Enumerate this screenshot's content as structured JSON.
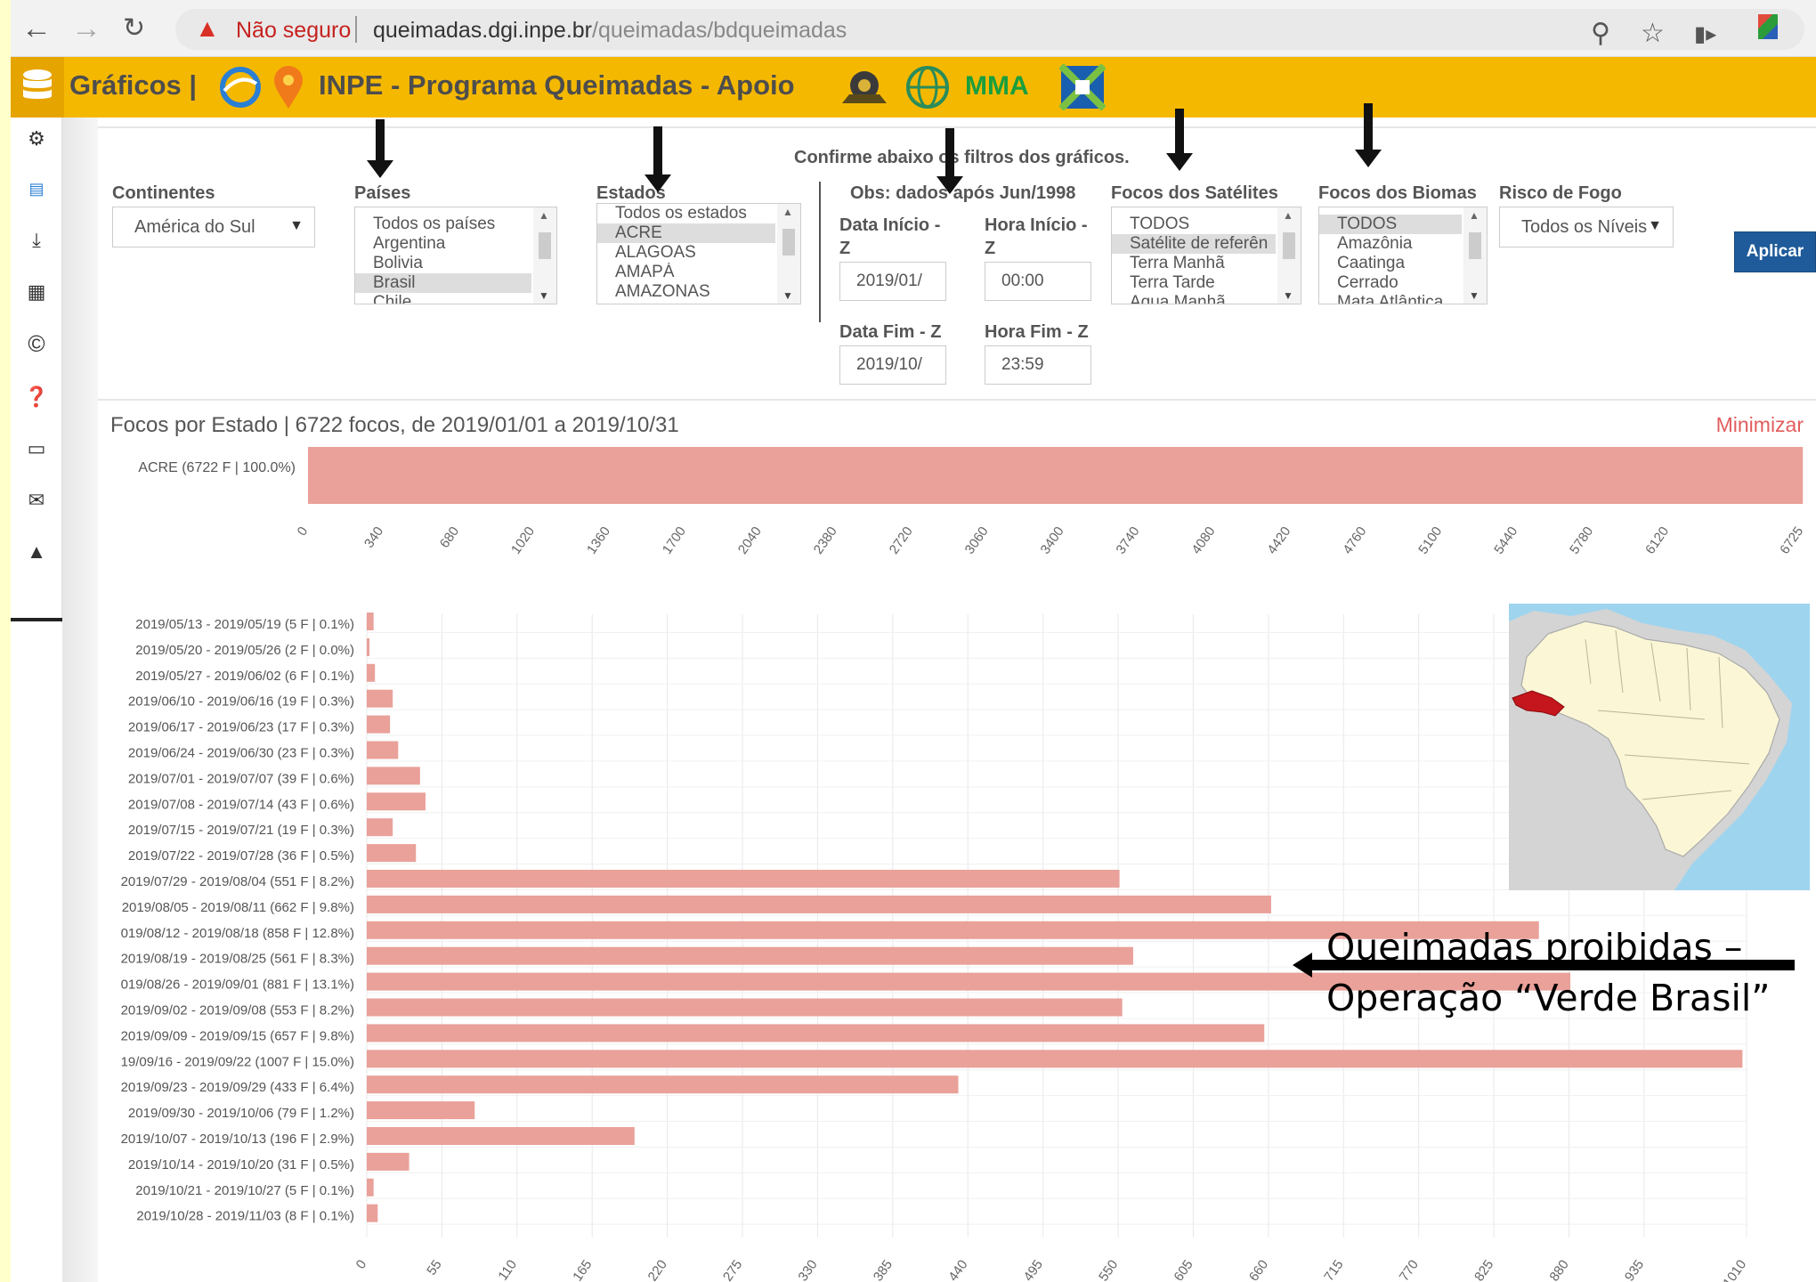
{
  "browser": {
    "back_icon": "back-arrow-icon",
    "security_label": "Não seguro",
    "url_host": "queimadas.dgi.inpe.br",
    "url_path": "/queimadas/bdqueimadas"
  },
  "header": {
    "title": "Gráficos |",
    "program": "INPE - Programa Queimadas - Apoio",
    "mma": "MMA",
    "bg_color": "#f5b800"
  },
  "filters": {
    "note": "Confirme abaixo os filtros dos gráficos.",
    "obs": "Obs: dados após Jun/1998",
    "continentes": {
      "label": "Continentes",
      "value": "América do Sul"
    },
    "paises": {
      "label": "Países",
      "options": [
        "Todos os países",
        "Argentina",
        "Bolivia",
        "Brasil",
        "Chile"
      ],
      "selected": "Brasil"
    },
    "estados": {
      "label": "Estados",
      "options": [
        "Todos os estados",
        "ACRE",
        "ALAGOAS",
        "AMAPÁ",
        "AMAZONAS"
      ],
      "selected": "ACRE"
    },
    "data_inicio": {
      "label_1": "Data Início -",
      "label_2": "Z",
      "value": "2019/01/"
    },
    "hora_inicio": {
      "label_1": "Hora Início -",
      "label_2": "Z",
      "value": "00:00"
    },
    "data_fim": {
      "label": "Data Fim - Z",
      "value": "2019/10/"
    },
    "hora_fim": {
      "label": "Hora Fim - Z",
      "value": "23:59"
    },
    "satelites": {
      "label": "Focos dos Satélites",
      "options": [
        "TODOS",
        "Satélite de referên",
        "Terra Manhã",
        "Terra Tarde",
        "Aqua Manhã"
      ],
      "selected": "Satélite de referên"
    },
    "biomas": {
      "label": "Focos dos Biomas",
      "options": [
        "TODOS",
        "Amazônia",
        "Caatinga",
        "Cerrado",
        "Mata Atlântica"
      ],
      "selected": "TODOS"
    },
    "risco": {
      "label": "Risco de Fogo",
      "value": "Todos os Níveis"
    },
    "apply_label": "Aplicar"
  },
  "chart_data": [
    {
      "type": "bar",
      "title": "Focos por Estado | 6722 focos, de 2019/01/01 a 2019/10/31",
      "categories": [
        "ACRE (6722 F | 100.0%)"
      ],
      "values": [
        6722
      ],
      "xlim": [
        0,
        6725
      ],
      "ticks": [
        0,
        340,
        680,
        1020,
        1360,
        1700,
        2040,
        2380,
        2720,
        3060,
        3400,
        3740,
        4080,
        4420,
        4760,
        5100,
        5440,
        5780,
        6120,
        6725
      ],
      "minimize_label": "Minimizar",
      "bar_color": "#e9a19a"
    },
    {
      "type": "bar",
      "categories": [
        "2019/05/13 - 2019/05/19 (5 F | 0.1%)",
        "2019/05/20 - 2019/05/26 (2 F | 0.0%)",
        "2019/05/27 - 2019/06/02 (6 F | 0.1%)",
        "2019/06/10 - 2019/06/16 (19 F | 0.3%)",
        "2019/06/17 - 2019/06/23 (17 F | 0.3%)",
        "2019/06/24 - 2019/06/30 (23 F | 0.3%)",
        "2019/07/01 - 2019/07/07 (39 F | 0.6%)",
        "2019/07/08 - 2019/07/14 (43 F | 0.6%)",
        "2019/07/15 - 2019/07/21 (19 F | 0.3%)",
        "2019/07/22 - 2019/07/28 (36 F | 0.5%)",
        "2019/07/29 - 2019/08/04 (551 F | 8.2%)",
        "2019/08/05 - 2019/08/11 (662 F | 9.8%)",
        "019/08/12 - 2019/08/18 (858 F | 12.8%)",
        "2019/08/19 - 2019/08/25 (561 F | 8.3%)",
        "019/08/26 - 2019/09/01 (881 F | 13.1%)",
        "2019/09/02 - 2019/09/08 (553 F | 8.2%)",
        "2019/09/09 - 2019/09/15 (657 F | 9.8%)",
        "19/09/16 - 2019/09/22 (1007 F | 15.0%)",
        "2019/09/23 - 2019/09/29 (433 F | 6.4%)",
        "2019/09/30 - 2019/10/06 (79 F | 1.2%)",
        "2019/10/07 - 2019/10/13 (196 F | 2.9%)",
        "2019/10/14 - 2019/10/20 (31 F | 0.5%)",
        "2019/10/21 - 2019/10/27 (5 F | 0.1%)",
        "2019/10/28 - 2019/11/03 (8 F | 0.1%)"
      ],
      "values": [
        5,
        2,
        6,
        19,
        17,
        23,
        39,
        43,
        19,
        36,
        551,
        662,
        858,
        561,
        881,
        553,
        657,
        1007,
        433,
        79,
        196,
        31,
        5,
        8
      ],
      "xlim": [
        0,
        1010
      ],
      "ticks": [
        0,
        55,
        110,
        165,
        220,
        275,
        330,
        385,
        440,
        495,
        550,
        605,
        660,
        715,
        770,
        825,
        880,
        935,
        1010
      ],
      "bar_color": "#e9a19a",
      "grid": true
    }
  ],
  "annotation": {
    "line1": "Queimadas proibidas –",
    "line2": "Operação “Verde Brasil”"
  }
}
